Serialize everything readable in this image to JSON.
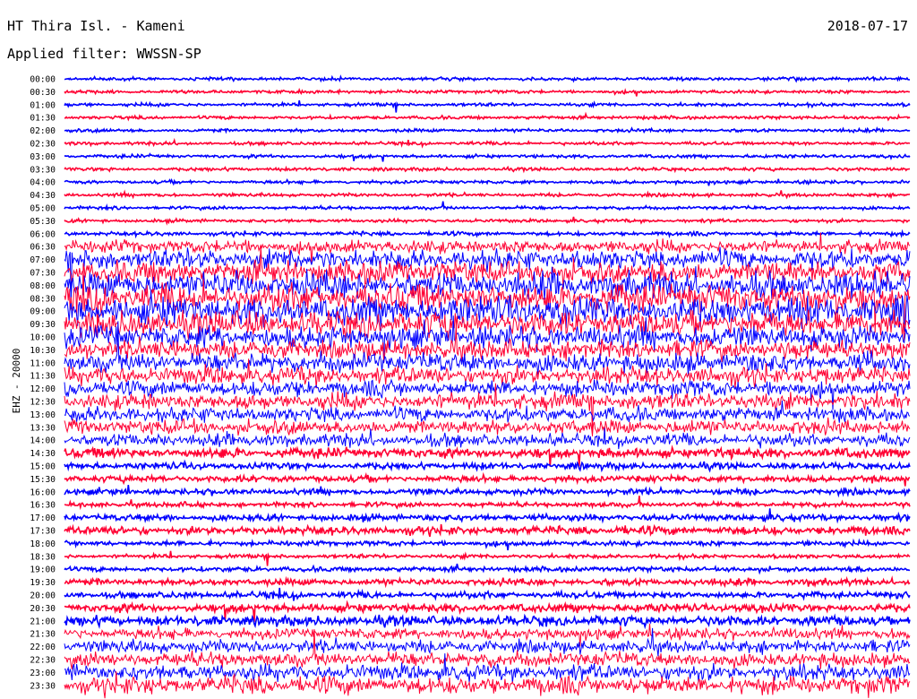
{
  "header": {
    "station": "HT Thira Isl. - Kameni",
    "date": "2018-07-17",
    "filter": "Applied filter: WWSSN-SP"
  },
  "chart_data": {
    "type": "seismogram-helicorder",
    "channel_label": "EHZ - 20000",
    "row_labels": [
      "00:00",
      "00:30",
      "01:00",
      "01:30",
      "02:00",
      "02:30",
      "03:00",
      "03:30",
      "04:00",
      "04:30",
      "05:00",
      "05:30",
      "06:00",
      "06:30",
      "07:00",
      "07:30",
      "08:00",
      "08:30",
      "09:00",
      "09:30",
      "10:00",
      "10:30",
      "11:00",
      "11:30",
      "12:00",
      "12:30",
      "13:00",
      "13:30",
      "14:00",
      "14:30",
      "15:00",
      "15:30",
      "16:00",
      "16:30",
      "17:00",
      "17:30",
      "18:00",
      "18:30",
      "19:00",
      "19:30",
      "20:00",
      "20:30",
      "21:00",
      "21:30",
      "22:00",
      "22:30",
      "23:00",
      "23:30"
    ],
    "colors": {
      "even_rows": "#0000ff",
      "odd_rows": "#ff0033"
    },
    "relative_noise_amplitude": [
      1,
      1,
      1,
      1,
      1,
      1,
      1,
      1,
      1,
      1,
      1,
      1,
      1.2,
      4,
      6,
      7,
      8,
      9,
      9,
      8,
      7,
      6,
      6,
      5.5,
      5,
      5,
      4.5,
      4.5,
      4,
      3,
      2,
      2,
      1.8,
      1.5,
      2,
      2.5,
      1.5,
      1.2,
      1.5,
      2,
      2,
      2.5,
      3,
      3.5,
      4,
      4.5,
      5,
      5.5
    ]
  }
}
